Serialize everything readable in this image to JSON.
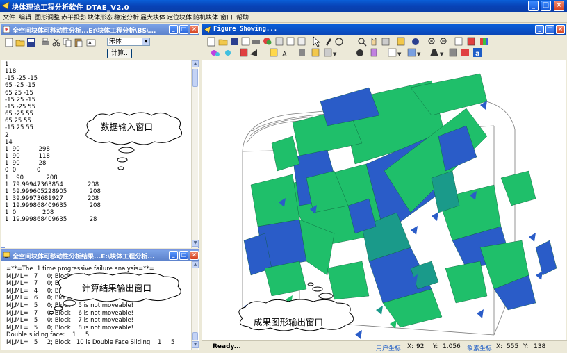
{
  "app": {
    "title": "块体理论工程分析软件 DTAE_V2.0",
    "window_buttons": [
      "_",
      "□",
      "×"
    ]
  },
  "menu": [
    "文件",
    "编辑",
    "图形调整",
    "赤平投影",
    "块体形态",
    "稳定分析",
    "最大块体",
    "定位块体",
    "随机块体",
    "窗口",
    "帮助"
  ],
  "input_pane": {
    "title": "全空间块体可移动性分析...E:\\块体工程分析\\BS\\...",
    "font_select": "宋体",
    "calc_button": "计算..",
    "lines": [
      "1",
      "118",
      "-15 -25 -15",
      "65 -25 -15",
      "65 25 -15",
      "-15 25 -15",
      "-15 -25 55",
      "65 -25 55",
      "65 25 55",
      "-15 25 55",
      "2",
      "14",
      "1  90          298",
      "1  90          118",
      "1  90          28",
      "0  0           0",
      "1    90            208",
      "1  79.99947363854             208",
      "1  59.999605228905            208",
      "1  39.99973681927             208",
      "1  19.999868409635            208",
      "1  0              208",
      "1  19.999868409635            28"
    ]
  },
  "result_pane": {
    "title": "全空间块体可移动性分析结果...E:\\块体工程分析...",
    "lines": [
      "=**=The  1 time progressive failure analysis=**=",
      "MJ,ML=   7     0; Block    1 is not moveable!",
      "MJ,ML=   7     0; Block    2 is not moveable!",
      "MJ,ML=   4     0; Block    3 is not moveable!",
      "MJ,ML=   6     0; Block    4 is not moveable!",
      "MJ,ML=   5     0; Block    5 is not moveable!",
      "MJ,ML=   7     0; Block    6 is not moveable!",
      "MJ,ML=   5     0; Block    7 is not moveable!",
      "MJ,ML=   5     0; Block    8 is not moveable!",
      "Double sliding face:    1     5",
      "MJ,ML=   5     2; Block   10 is Double Face Sliding    1     5",
      "..."
    ]
  },
  "figure_pane": {
    "title": "Figure Showing..."
  },
  "callouts": {
    "input": "数据输入窗口",
    "result": "计算结果输出窗口",
    "figure": "成果图形输出窗口"
  },
  "status": {
    "ready": "Ready...",
    "user_coord_label": "用户坐标",
    "x_label": "X:",
    "x_value": "92",
    "y_label": "Y:",
    "y_value": "1.056",
    "pixel_coord_label": "象素坐标",
    "px_label": "X:",
    "px_value": "555",
    "py_label": "Y:",
    "py_value": "138"
  },
  "colors": {
    "title_blue": "#0a46b8",
    "face_green": "#1fbf6a",
    "face_blue": "#2a5cc8",
    "face_teal": "#1a9a8a"
  }
}
